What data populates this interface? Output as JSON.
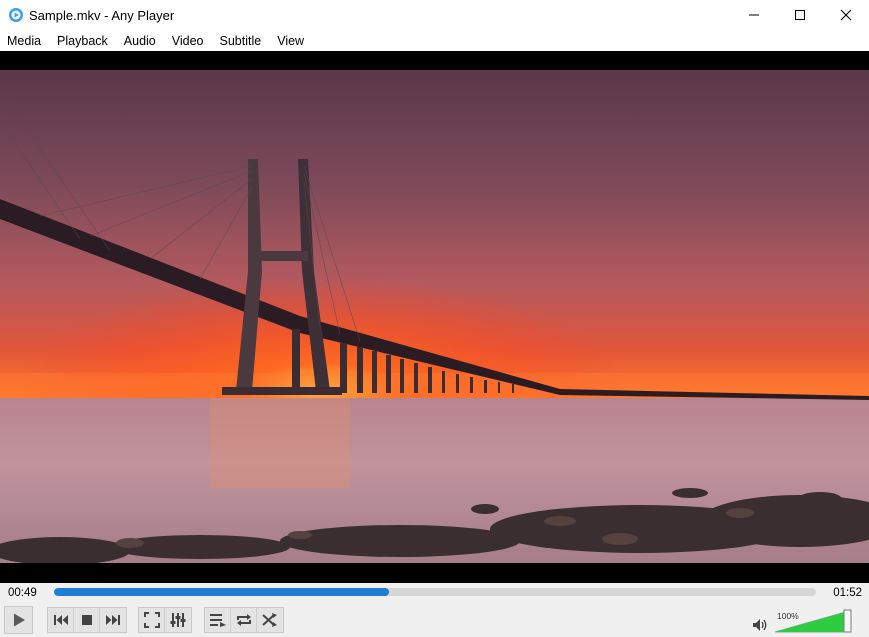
{
  "window": {
    "title": "Sample.mkv - Any Player"
  },
  "menu": [
    {
      "label": "Media"
    },
    {
      "label": "Playback"
    },
    {
      "label": "Audio"
    },
    {
      "label": "Video"
    },
    {
      "label": "Subtitle"
    },
    {
      "label": "View"
    }
  ],
  "video": {
    "scene": "bridge-at-sunset"
  },
  "playback": {
    "current_time": "00:49",
    "total_time": "01:52",
    "progress_fraction": 0.44
  },
  "volume": {
    "label": "100%",
    "level_fraction": 1.0
  },
  "icons": {
    "play": "play-icon",
    "prev": "skip-previous-icon",
    "stop": "stop-icon",
    "next": "skip-next-icon",
    "fullscreen": "fullscreen-icon",
    "equalizer": "equalizer-icon",
    "playlist": "playlist-icon",
    "repeat": "repeat-icon",
    "shuffle": "shuffle-icon",
    "volume": "speaker-icon"
  },
  "colors": {
    "accent": "#1f7fd6",
    "volume_fill": "#2ecc40"
  }
}
